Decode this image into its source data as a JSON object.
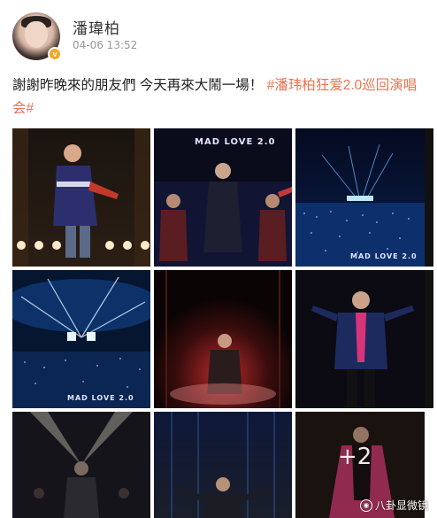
{
  "author": {
    "name": "潘瑋柏",
    "timestamp": "04-06 13:52",
    "verified_badge": "v"
  },
  "post": {
    "text": "謝謝昨晚來的朋友們 今天再來大鬧一場！",
    "hashtag": "#潘玮柏狂爱2.0巡回演唱会#"
  },
  "photos": [
    {
      "id": "p1",
      "caption": ""
    },
    {
      "id": "p2",
      "caption": "MAD LOVE 2.0"
    },
    {
      "id": "p3",
      "caption": "MAD LOVE 2.0"
    },
    {
      "id": "p4",
      "caption": "MAD LOVE 2.0"
    },
    {
      "id": "p5",
      "caption": ""
    },
    {
      "id": "p6",
      "caption": ""
    },
    {
      "id": "p7",
      "caption": ""
    },
    {
      "id": "p8",
      "caption": ""
    },
    {
      "id": "p9",
      "caption": "+2"
    }
  ],
  "watermark": {
    "text": "八卦显微镜",
    "icon": "eye-icon"
  },
  "colors": {
    "hashtag": "#eb7350",
    "badge": "#f6a623",
    "timestamp": "#999999"
  }
}
